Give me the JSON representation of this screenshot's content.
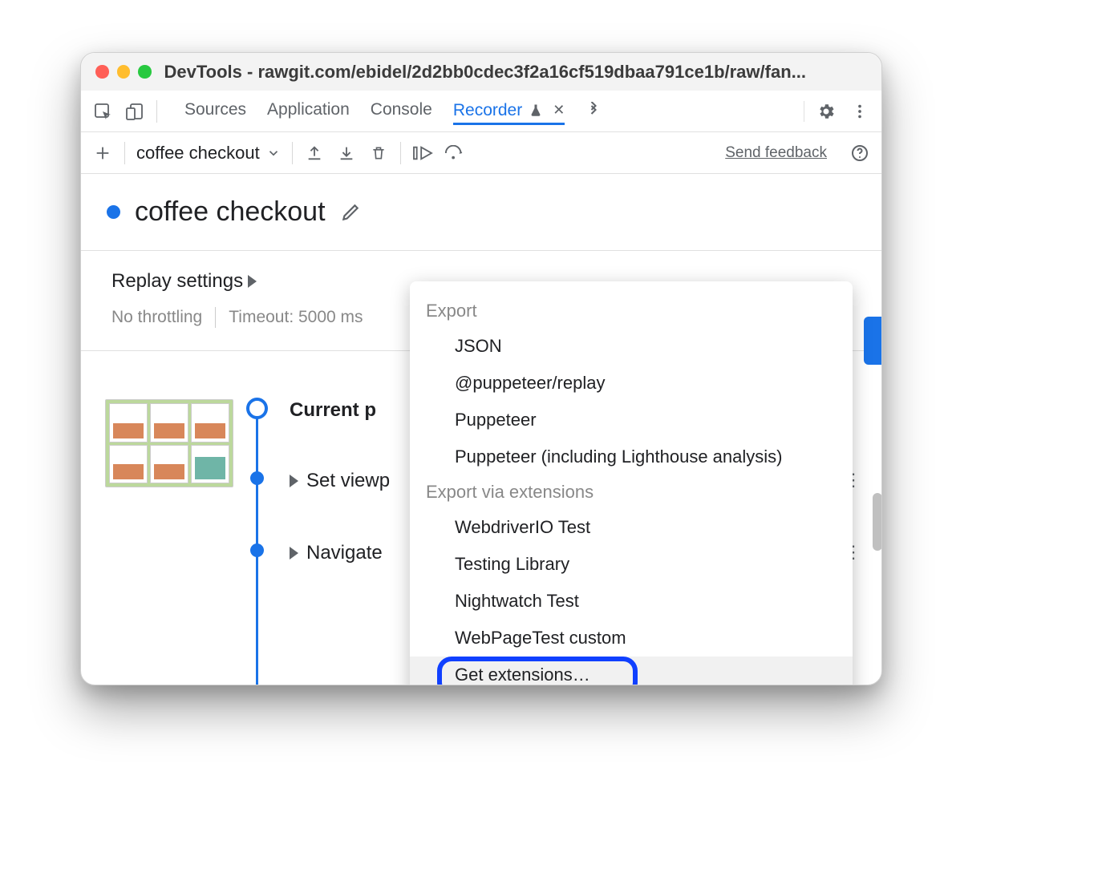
{
  "window": {
    "title": "DevTools - rawgit.com/ebidel/2d2bb0cdec3f2a16cf519dbaa791ce1b/raw/fan..."
  },
  "tabstrip": {
    "tabs": [
      "Sources",
      "Application",
      "Console"
    ],
    "active_tab": "Recorder"
  },
  "toolbar": {
    "recording_name": "coffee checkout",
    "feedback": "Send feedback"
  },
  "recording": {
    "title": "coffee checkout"
  },
  "settings": {
    "heading": "Replay settings",
    "throttling": "No throttling",
    "timeout": "Timeout: 5000 ms"
  },
  "timeline": {
    "step0": "Current p",
    "step1": "Set viewp",
    "step2": "Navigate"
  },
  "dropdown": {
    "section1": "Export",
    "items1": [
      "JSON",
      "@puppeteer/replay",
      "Puppeteer",
      "Puppeteer (including Lighthouse analysis)"
    ],
    "section2": "Export via extensions",
    "items2": [
      "WebdriverIO Test",
      "Testing Library",
      "Nightwatch Test",
      "WebPageTest custom"
    ],
    "get_ext": "Get extensions…"
  }
}
